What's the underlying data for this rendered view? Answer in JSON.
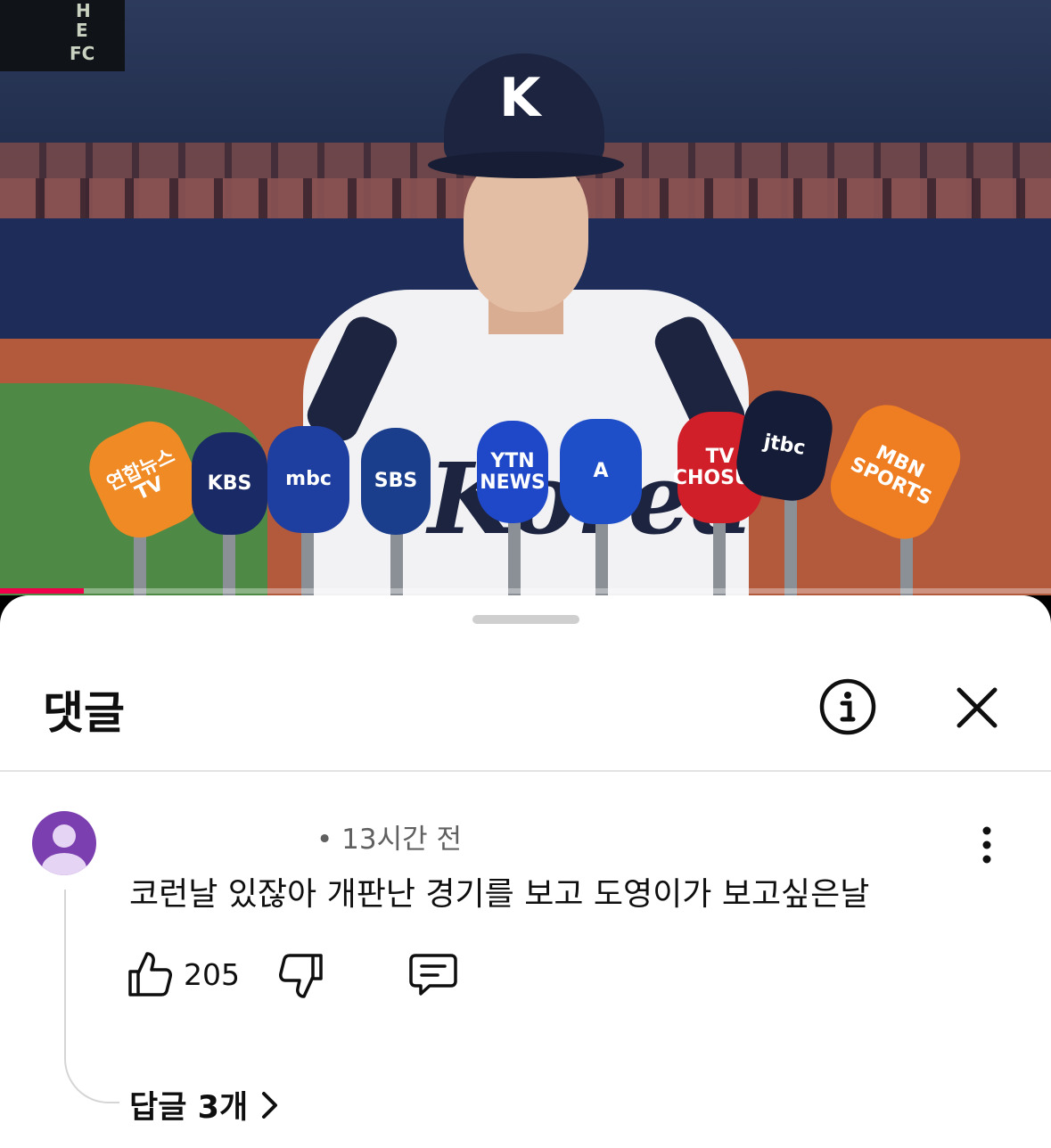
{
  "video": {
    "scoreboard_letters": [
      "H",
      "E",
      "FC"
    ],
    "cap_logo": "K",
    "jersey_text": "Korea",
    "progress_fraction": 0.08,
    "accent_color": "#f0004a",
    "microphones": [
      {
        "label": "연합뉴스\nTV",
        "color": "#f08a24"
      },
      {
        "label": "KBS",
        "color": "#1a2a66"
      },
      {
        "label": "mbc",
        "color": "#1f3fa0"
      },
      {
        "label": "SBS",
        "color": "#1a3e8c"
      },
      {
        "label": "YTN\nNEWS",
        "color": "#1f48c8"
      },
      {
        "label": "A",
        "color": "#1f4fc8"
      },
      {
        "label": "TV\nCHOSUN",
        "color": "#d11f2a"
      },
      {
        "label": "jtbc",
        "color": "#141c38"
      },
      {
        "label": "MBN\nSPORTS",
        "color": "#ef7d22"
      }
    ]
  },
  "comments_sheet": {
    "title": "댓글",
    "info_icon": "info-circle-icon",
    "close_icon": "close-icon",
    "comment": {
      "author": "",
      "time": "• 13시간 전",
      "text": "코런날 있잖아 개판난 경기를 보고 도영이가 보고싶은날",
      "likes": "205",
      "replies_label": "답글 3개"
    }
  }
}
